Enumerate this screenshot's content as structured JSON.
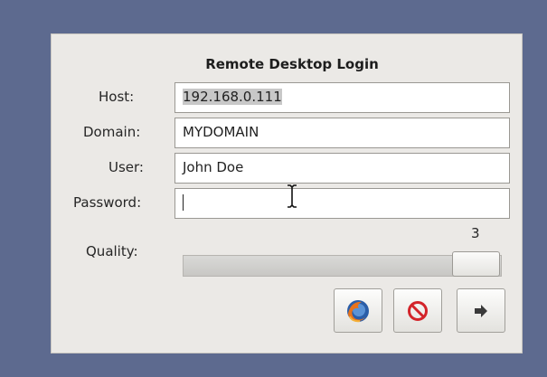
{
  "dialog": {
    "title": "Remote Desktop Login",
    "host": {
      "label": "Host:",
      "value": "192.168.0.111"
    },
    "domain": {
      "label": "Domain:",
      "value": "MYDOMAIN"
    },
    "user": {
      "label": "User:",
      "value": "John Doe"
    },
    "password": {
      "label": "Password:",
      "value": ""
    },
    "quality": {
      "label": "Quality:",
      "value": "3",
      "level": 3
    },
    "buttons": [
      {
        "name": "browser",
        "icon": "firefox-icon"
      },
      {
        "name": "cancel",
        "icon": "no-entry-icon"
      },
      {
        "name": "connect",
        "icon": "arrow-right-icon"
      }
    ]
  },
  "colors": {
    "background": "#5d6a8f",
    "dialog": "#ebe9e6",
    "stop_red": "#d3242a"
  }
}
